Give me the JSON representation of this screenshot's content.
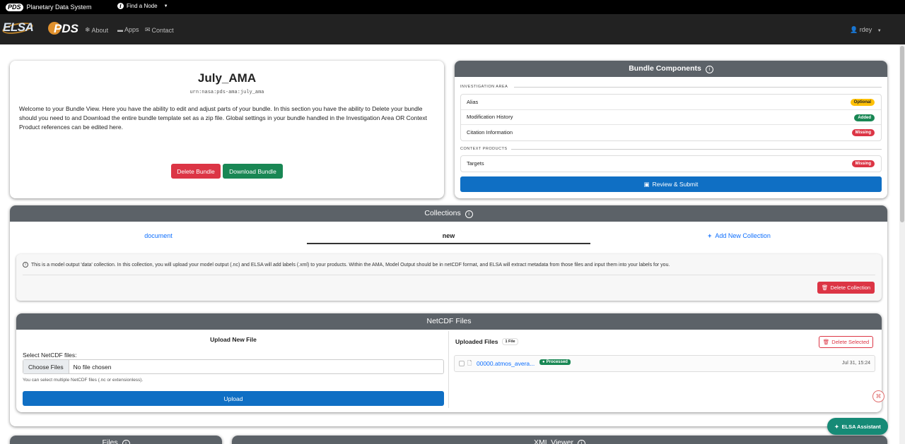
{
  "topbar": {
    "logo": "PDS",
    "title": "Planetary Data System",
    "find_node": "Find a Node"
  },
  "nav": {
    "elsa_logo": "ELSA",
    "pds_logo": "PDS",
    "links": [
      {
        "label": "About",
        "icon": "snowflake-icon"
      },
      {
        "label": "Apps",
        "icon": "briefcase-icon"
      },
      {
        "label": "Contact",
        "icon": "envelope-icon"
      }
    ],
    "user": "rdey"
  },
  "bundle": {
    "title": "July_AMA",
    "urn": "urn:nasa:pds-ama:july_ama",
    "description": "Welcome to your Bundle View. Here you have the ability to edit and adjust parts of your bundle. In this section you have the ability to Delete your bundle should you need to and Download the entire bundle template set as a zip file. Global settings in your bundle handled in the Investigation Area OR Context Product references can be edited here.",
    "delete_label": "Delete Bundle",
    "download_label": "Download Bundle"
  },
  "components": {
    "title": "Bundle Components",
    "investigation_label": "INVESTIGATION AREA",
    "investigation_items": [
      {
        "label": "Alias",
        "status": "Optional"
      },
      {
        "label": "Modification History",
        "status": "Added"
      },
      {
        "label": "Citation Information",
        "status": "Missing"
      }
    ],
    "context_label": "CONTEXT PRODUCTS",
    "context_items": [
      {
        "label": "Targets",
        "status": "Missing"
      }
    ],
    "review_label": "Review & Submit"
  },
  "collections": {
    "title": "Collections",
    "tabs": [
      "document",
      "new",
      "Add New Collection"
    ],
    "info_text": "This is a model output 'data' collection. In this collection, you will upload your model output (.nc) and ELSA will add labels (.xml) to your products. Within the AMA, Model Output should be in netCDF format, and ELSA will extract metadata from those files and input them into your labels for you.",
    "delete_label": "Delete Collection"
  },
  "netcdf": {
    "title": "NetCDF Files",
    "upload_title": "Upload New File",
    "select_label": "Select NetCDF files:",
    "choose_label": "Choose Files",
    "no_file": "No file chosen",
    "help_text": "You can select multiple NetCDF files (.nc or extensionless).",
    "upload_label": "Upload",
    "uploaded_title": "Uploaded Files",
    "file_count": "1 File",
    "delete_selected": "Delete Selected",
    "files": [
      {
        "name": "00000.atmos_avera...",
        "status": "Processed",
        "date": "Jul 31, 15:24"
      }
    ]
  },
  "bottom": {
    "files_title": "Files",
    "xml_title": "XML Viewer"
  },
  "assistant_label": "ELSA Assistant"
}
